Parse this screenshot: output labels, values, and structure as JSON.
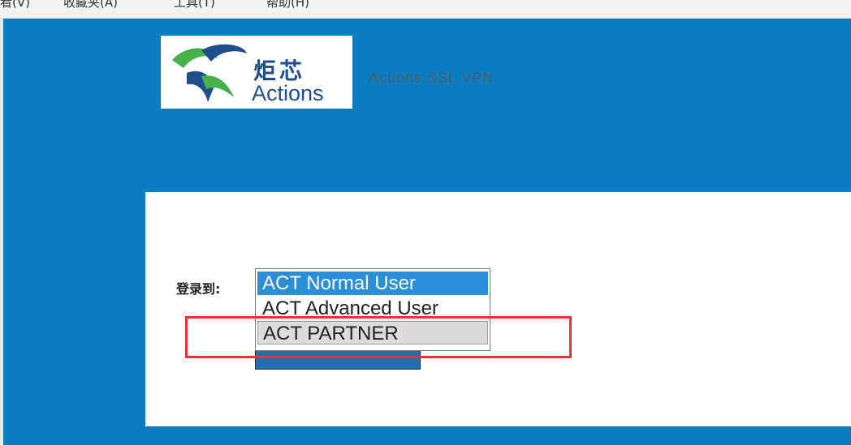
{
  "menubar": {
    "items": [
      {
        "label": "看(V)"
      },
      {
        "label": "收藏夹(A)"
      },
      {
        "label": "工具(T)"
      },
      {
        "label": "帮助(H)"
      }
    ]
  },
  "header": {
    "logo_cn": "炬芯",
    "logo_en": "Actions",
    "site_title": "Actions SSL VPN"
  },
  "login": {
    "label": "登录到:",
    "selected": "ACT Normal User",
    "options": [
      "ACT Normal User",
      "ACT Advanced User",
      "ACT PARTNER"
    ]
  },
  "colors": {
    "page_background": "#0b7dc0",
    "selected_option": "#2a8ed8",
    "highlight_border": "#e63232"
  }
}
